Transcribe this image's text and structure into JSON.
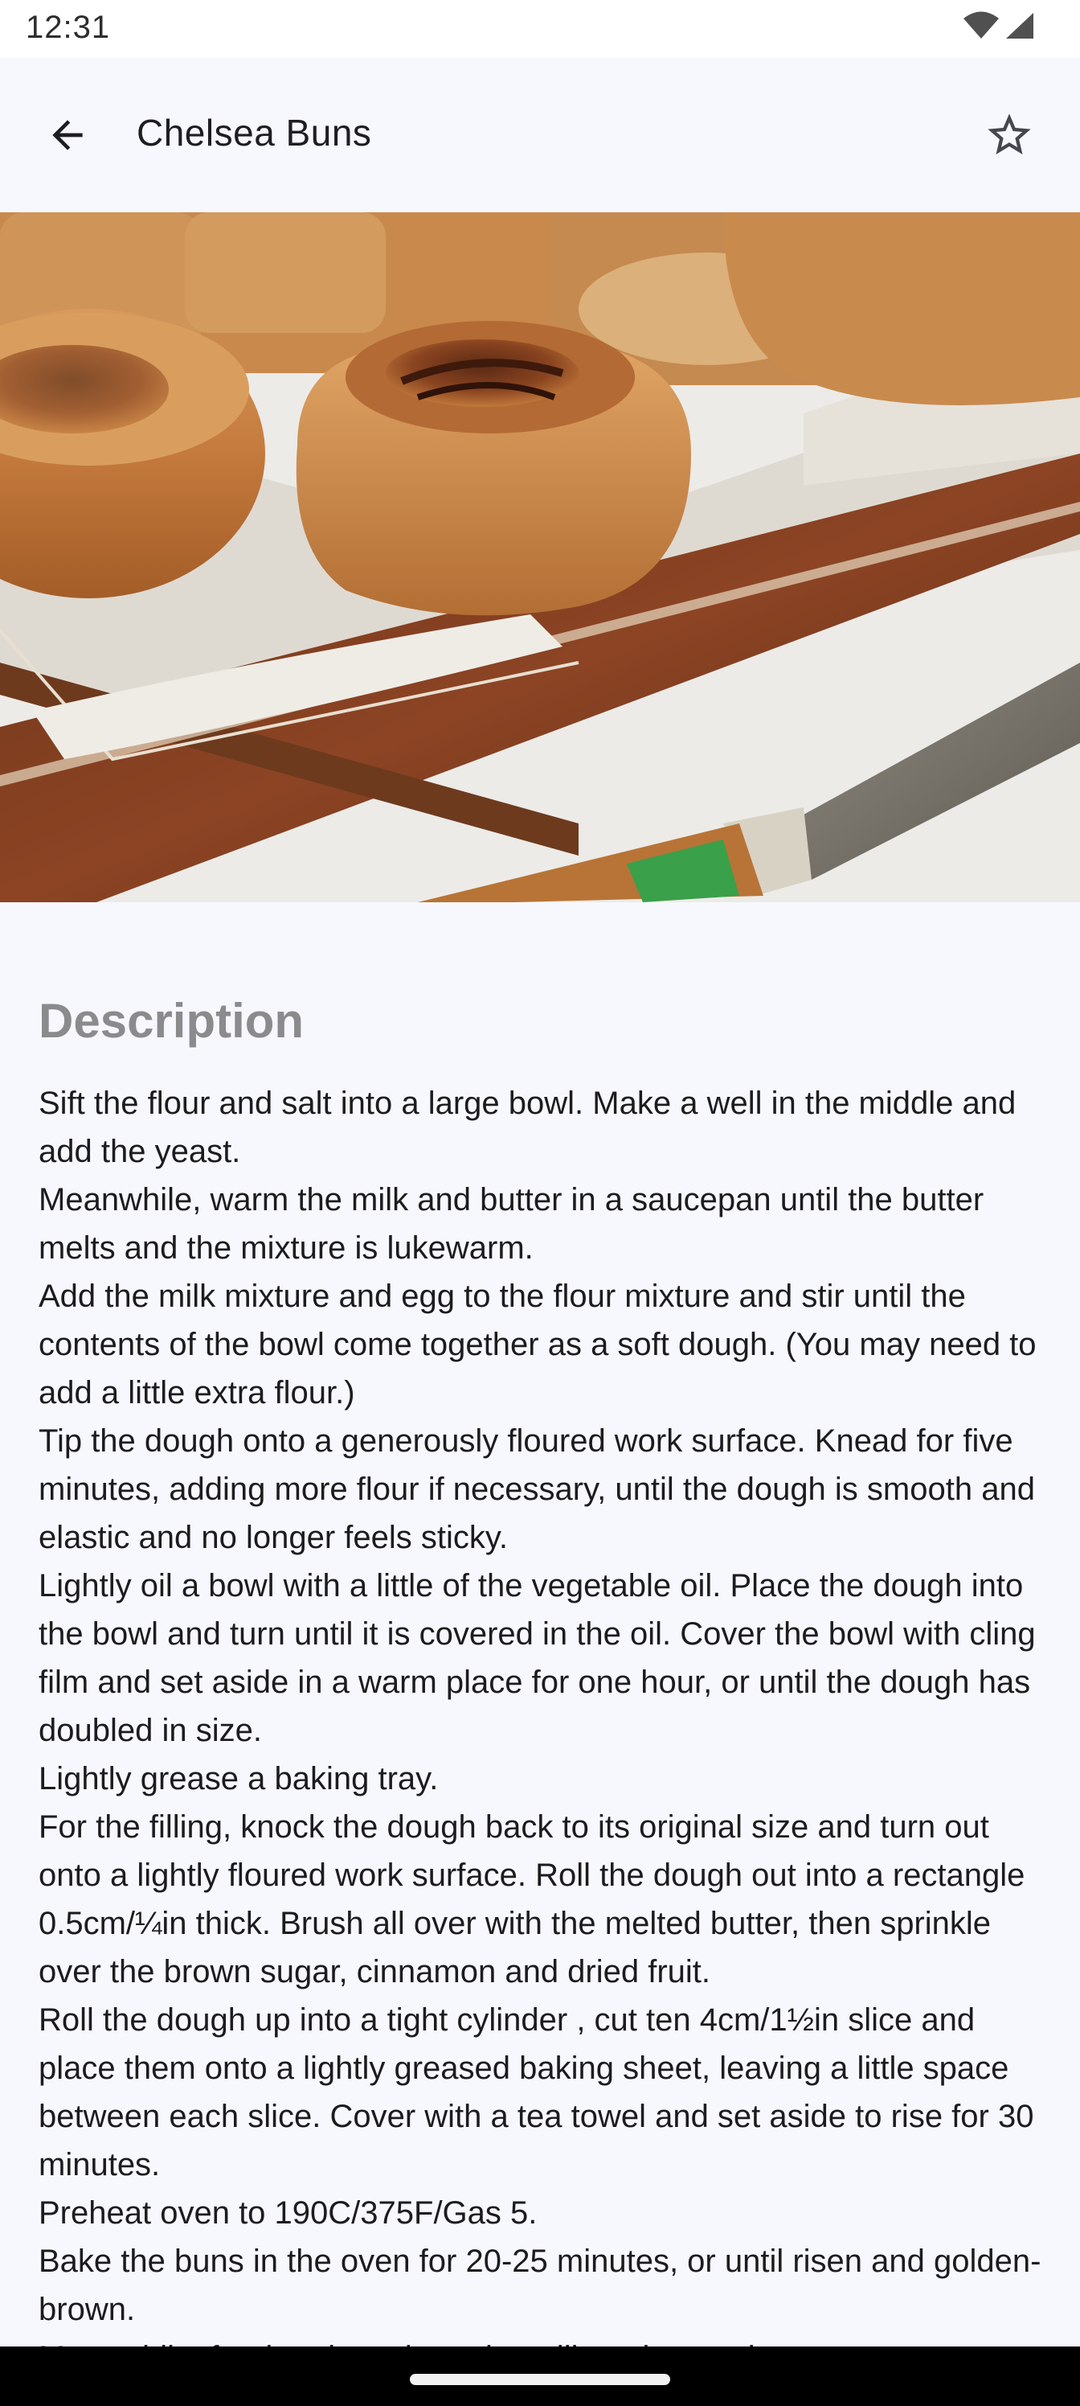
{
  "status_bar": {
    "time": "12:31",
    "wifi_icon": "wifi-icon",
    "signal_icon": "cell-signal-icon"
  },
  "app_bar": {
    "title": "Chelsea Buns",
    "back_icon": "arrow-back-icon",
    "favorite_icon": "star-outline-icon"
  },
  "hero": {
    "subject": "recipe-photo"
  },
  "description": {
    "heading": "Description",
    "steps": [
      "Sift the flour and salt into a large bowl. Make a well in the middle and add the yeast.",
      "Meanwhile, warm the milk and butter in a saucepan until the butter melts and the mixture is lukewarm.",
      "Add the milk mixture and egg to the flour mixture and stir until the contents of the bowl come together as a soft dough. (You may need to add a little extra flour.)",
      "Tip the dough onto a generously floured work surface. Knead for five minutes, adding more flour if necessary, until the dough is smooth and elastic and no longer feels sticky.",
      "Lightly oil a bowl with a little of the vegetable oil. Place the dough into the bowl and turn until it is covered in the oil. Cover the bowl with cling film and set aside in a warm place for one hour, or until the dough has doubled in size.",
      "Lightly grease a baking tray.",
      "For the filling, knock the dough back to its original size and turn out onto a lightly floured work surface. Roll the dough out into a rectangle 0.5cm/¼in thick. Brush all over with the melted butter, then sprinkle over the brown sugar, cinnamon and dried fruit.",
      "Roll the dough up into a tight cylinder , cut ten 4cm/1½in slice and place them onto a lightly greased baking sheet, leaving a little space between each slice. Cover with a tea towel and set aside to rise for 30 minutes.",
      "Preheat oven to 190C/375F/Gas 5.",
      "Bake the buns in the oven for 20-25 minutes, or until risen and golden-brown.",
      "Meanwhile, for the glaze, heat the milk and sugar in a saucepan"
    ]
  },
  "colors": {
    "background": "#f7f8fd",
    "heading": "#8b8b8e",
    "text": "#1c1c1f"
  }
}
